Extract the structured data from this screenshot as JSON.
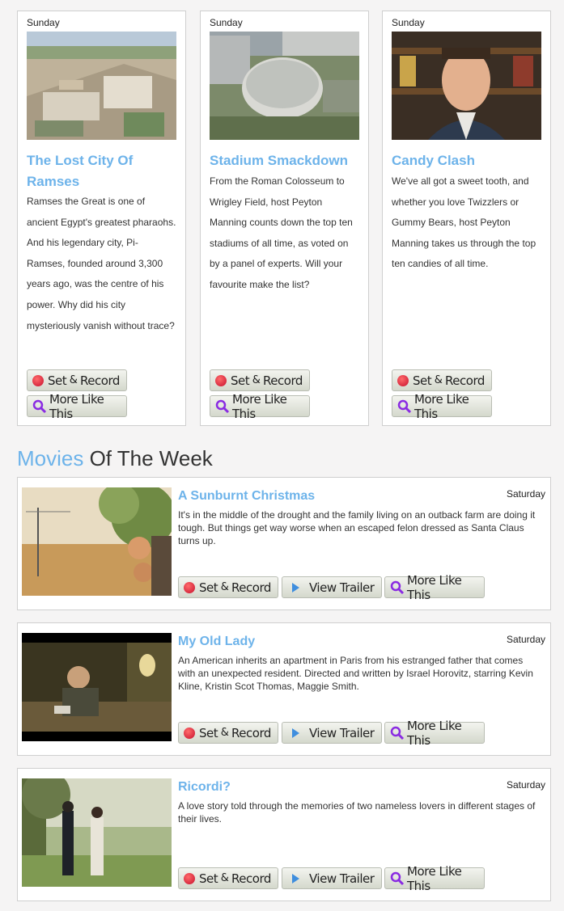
{
  "shows": [
    {
      "day": "Sunday",
      "title": "The Lost City Of Ramses",
      "description": "Ramses the Great is one of ancient Egypt's greatest pharaohs. And his legendary city, Pi-Ramses, founded around 3,300 years ago, was the centre of his power. Why did his city mysteriously vanish without trace?",
      "thumb": "ancient-city-aerial"
    },
    {
      "day": "Sunday",
      "title": "Stadium Smackdown",
      "description": "From the Roman Colosseum to Wrigley Field, host Peyton Manning counts down the top ten stadiums of all time, as voted on by a panel of experts. Will your favourite make the list?",
      "thumb": "domed-stadium-aerial"
    },
    {
      "day": "Sunday",
      "title": "Candy Clash",
      "description": "We've all got a sweet tooth, and whether you love Twizzlers or Gummy Bears, host Peyton Manning takes us through the top ten candies of all time.",
      "thumb": "host-portrait"
    }
  ],
  "buttons": {
    "set_record_a": "Set",
    "set_record_amp": " & ",
    "set_record_b": "Record",
    "more_like_this": "More Like This",
    "view_trailer": "View Trailer"
  },
  "section": {
    "title_highlight": "Movies",
    "title_rest": " Of The Week"
  },
  "movies": [
    {
      "title": "A Sunburnt Christmas",
      "day": "Saturday",
      "description": "It's in the middle of the drought and the family living on an outback farm are doing it tough. But things get way worse when an escaped felon dressed as Santa Claus turns up.",
      "thumb": "outback-family"
    },
    {
      "title": "My Old Lady",
      "day": "Saturday",
      "description": "An American inherits an apartment in Paris from his estranged father that comes with an unexpected resident. Directed and written by Israel Horovitz, starring Kevin Kline, Kristin Scot Thomas, Maggie Smith.",
      "thumb": "woman-pouring-tea"
    },
    {
      "title": "Ricordi?",
      "day": "Saturday",
      "description": "A love story told through the memories of two nameless lovers in different stages of their lives.",
      "thumb": "couple-in-park"
    }
  ],
  "colors": {
    "accent": "#6db3ea",
    "record": "#c8102e",
    "magnifier": "#8a2be2",
    "play": "#3f8ede"
  }
}
